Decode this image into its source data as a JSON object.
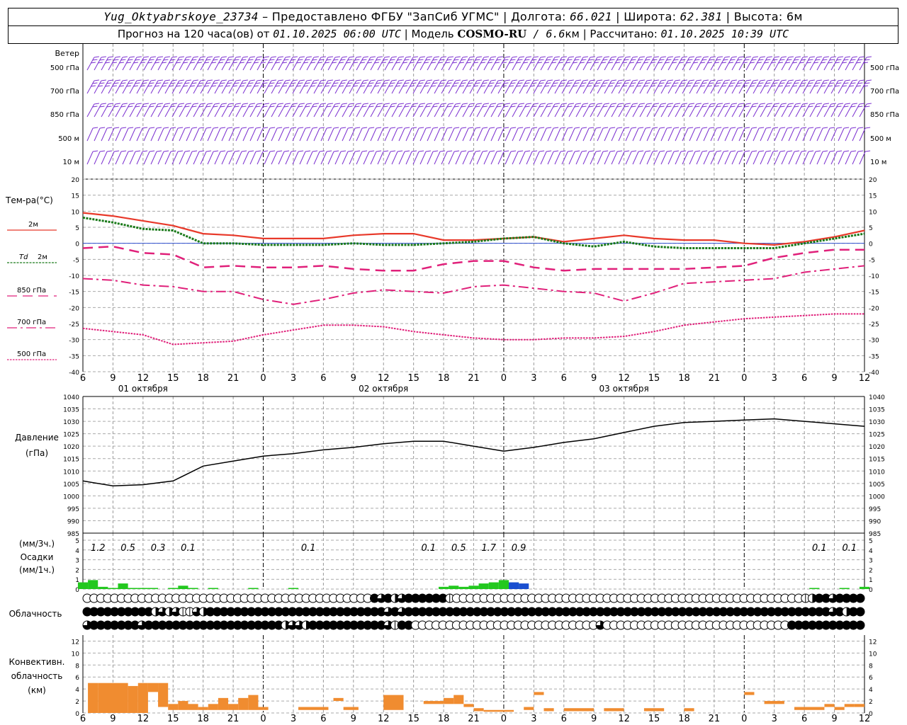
{
  "header": {
    "station": "Yug_Oktyabrskoye_23734",
    "provided_by": " – Предоставлено ФГБУ \"ЗапСиб УГМС\" | ",
    "lon_label": "Долгота: ",
    "lon_value": "66.021",
    "lat_label": " | Широта: ",
    "lat_value": "62.381",
    "alt_label": " | Высота: 6м",
    "forecast_label": "Прогноз на 120 часа(ов) от ",
    "forecast_start": "01.10.2025 06:00 UTC",
    "model_label": " | Модель ",
    "model_name": "COSMO-RU",
    "model_res": " / 6.6",
    "model_res_unit": "км",
    "calc_label": " | Рассчитано: ",
    "calc_time": "01.10.2025 10:39 UTC"
  },
  "time_axis": {
    "tick_labels": [
      "6",
      "9",
      "12",
      "15",
      "18",
      "21",
      "0",
      "3",
      "6",
      "9",
      "12",
      "15",
      "18",
      "21",
      "0",
      "3",
      "6",
      "9",
      "12",
      "15",
      "18",
      "21",
      "0",
      "3",
      "6",
      "9",
      "12"
    ],
    "day_labels": [
      "01 октября",
      "02 октября",
      "03 октября"
    ]
  },
  "wind_panel": {
    "title": "Ветер",
    "levels": [
      "500 гПа",
      "700 гПа",
      "850 гПа",
      "500 м",
      "10  м"
    ],
    "color": "#7b2fd0"
  },
  "temp_panel": {
    "title": "Тем-ра(°C)",
    "y_ticks": [
      "20",
      "15",
      "10",
      "5",
      "0",
      "-5",
      "-10",
      "-15",
      "-20",
      "-25",
      "-30",
      "-35",
      "-40"
    ],
    "legend": [
      {
        "label": "2м",
        "color": "#e8392a"
      },
      {
        "label": "Td",
        "label2": "2м",
        "color": "#1a7a1a"
      },
      {
        "label": "850 гПа",
        "color": "#e0207a"
      },
      {
        "label": "700 гПа",
        "color": "#e0207a"
      },
      {
        "label": "500 гПа",
        "color": "#e0207a"
      }
    ]
  },
  "pressure_panel": {
    "title": "Давление",
    "unit": "(гПа)",
    "y_ticks": [
      "1040",
      "1035",
      "1030",
      "1025",
      "1020",
      "1015",
      "1010",
      "1005",
      "1000",
      "995",
      "990",
      "985"
    ]
  },
  "precip_panel": {
    "unit_top": "(мм/3ч.)",
    "title": "Осадки",
    "unit_bottom": "(мм/1ч.)",
    "y_ticks": [
      "5",
      "4",
      "3",
      "2",
      "1",
      "0"
    ],
    "labels": [
      {
        "hour": 1.5,
        "text": "1.2"
      },
      {
        "hour": 4.5,
        "text": "0.5"
      },
      {
        "hour": 7.5,
        "text": "0.3"
      },
      {
        "hour": 10.5,
        "text": "0.1"
      },
      {
        "hour": 22.5,
        "text": "0.1"
      },
      {
        "hour": 34.5,
        "text": "0.1"
      },
      {
        "hour": 37.5,
        "text": "0.5"
      },
      {
        "hour": 40.5,
        "text": "1.7"
      },
      {
        "hour": 43.5,
        "text": "0.9"
      },
      {
        "hour": 73.5,
        "text": "0.1"
      },
      {
        "hour": 76.5,
        "text": "0.1"
      }
    ]
  },
  "cloud_panel": {
    "title": "Облачность"
  },
  "conv_panel": {
    "title1": "Конвективн.",
    "title2": "облачность",
    "unit": "(км)",
    "y_ticks": [
      "12",
      "10",
      "8",
      "6",
      "4",
      "2",
      "0"
    ],
    "color": "#f08c30"
  },
  "chart_data": [
    {
      "type": "line",
      "title": "Тем-ра(°C)",
      "ylim": [
        -40,
        20
      ],
      "x_hours_from_start": [
        0,
        3,
        6,
        9,
        12,
        15,
        18,
        21,
        24,
        27,
        30,
        33,
        36,
        39,
        42,
        45,
        48,
        51,
        54,
        57,
        60,
        63,
        66,
        69,
        72,
        75,
        78
      ],
      "series": [
        {
          "name": "2м",
          "values": [
            9.5,
            8.5,
            7,
            5.5,
            3,
            2.5,
            1.5,
            1.5,
            1.5,
            2.5,
            3,
            3,
            1,
            1,
            1.5,
            2,
            0.5,
            1.5,
            2.5,
            1.5,
            1,
            1,
            0,
            -0.5,
            0.5,
            2,
            4
          ]
        },
        {
          "name": "Td 2м",
          "values": [
            8,
            6.5,
            4.5,
            4,
            0,
            0,
            -0.5,
            -0.5,
            -0.5,
            0,
            -0.5,
            -0.5,
            0,
            0.5,
            1.5,
            2,
            0,
            -1,
            0.5,
            -1,
            -1.5,
            -1.5,
            -1.5,
            -1.5,
            0,
            1.5,
            3
          ]
        },
        {
          "name": "850 гПа",
          "values": [
            -1.5,
            -1,
            -3,
            -3.5,
            -7.5,
            -7,
            -7.5,
            -7.5,
            -7,
            -8,
            -8.5,
            -8.5,
            -6.5,
            -5.5,
            -5.5,
            -7.5,
            -8.5,
            -8,
            -8,
            -8,
            -8,
            -7.5,
            -7,
            -4.5,
            -3,
            -2,
            -2
          ]
        },
        {
          "name": "700 гПа",
          "values": [
            -11,
            -11.5,
            -13,
            -13.5,
            -15,
            -15,
            -17.5,
            -19,
            -17.5,
            -15.5,
            -14.5,
            -15,
            -15.5,
            -13.5,
            -13,
            -14,
            -15,
            -15.5,
            -18,
            -15.5,
            -12.5,
            -12,
            -11.5,
            -11,
            -9,
            -8,
            -7
          ]
        },
        {
          "name": "500 гПа",
          "values": [
            -26.5,
            -27.5,
            -28.5,
            -31.5,
            -31,
            -30.5,
            -28.5,
            -27,
            -25.5,
            -25.5,
            -26,
            -27.5,
            -28.5,
            -29.5,
            -30,
            -30,
            -29.5,
            -29.5,
            -29,
            -27.5,
            -25.5,
            -24.5,
            -23.5,
            -23,
            -22.5,
            -22,
            -22
          ]
        }
      ]
    },
    {
      "type": "line",
      "title": "Давление",
      "ylabel": "(гПа)",
      "ylim": [
        985,
        1040
      ],
      "x_hours_from_start": [
        0,
        3,
        6,
        9,
        12,
        15,
        18,
        21,
        24,
        27,
        30,
        33,
        36,
        39,
        42,
        45,
        48,
        51,
        54,
        57,
        60,
        63,
        66,
        69,
        72,
        75,
        78
      ],
      "series": [
        {
          "name": "Давление",
          "values": [
            1006,
            1004,
            1004.5,
            1006,
            1012,
            1014,
            1016,
            1017,
            1018.5,
            1019.5,
            1021,
            1022,
            1022,
            1020,
            1018,
            1019.5,
            1021.5,
            1023,
            1025.5,
            1028,
            1029.5,
            1030,
            1030.5,
            1031,
            1030,
            1029,
            1028
          ]
        }
      ]
    },
    {
      "type": "bar",
      "title": "Осадки",
      "ylabel": "(мм/1ч.)",
      "ylim": [
        0,
        5
      ],
      "x_hours_from_start": [
        0,
        1,
        2,
        3,
        4,
        5,
        6,
        7,
        8,
        9,
        10,
        11,
        12,
        13,
        14,
        15,
        16,
        17,
        18,
        19,
        20,
        21,
        22,
        23,
        24,
        25,
        26,
        27,
        28,
        29,
        30,
        31,
        32,
        33,
        34,
        35,
        36,
        37,
        38,
        39,
        40,
        41,
        42,
        43,
        44,
        45,
        46,
        47,
        48,
        49,
        50,
        51,
        52,
        53,
        54,
        55,
        56,
        57,
        58,
        59,
        60,
        61,
        62,
        63,
        64,
        65,
        66,
        67,
        68,
        69,
        70,
        71,
        72,
        73,
        74,
        75,
        76,
        77,
        78
      ],
      "series": [
        {
          "name": "rain",
          "values": [
            0.6,
            0.8,
            0.2,
            0.1,
            0.5,
            0.1,
            0.1,
            0.1,
            0,
            0.1,
            0.3,
            0.1,
            0,
            0.1,
            0,
            0,
            0,
            0.1,
            0,
            0,
            0,
            0.1,
            0,
            0,
            0,
            0,
            0,
            0,
            0,
            0,
            0,
            0,
            0,
            0,
            0,
            0,
            0.2,
            0.3,
            0.2,
            0.3,
            0.5,
            0.6,
            0.8,
            0.6,
            0,
            0,
            0,
            0,
            0,
            0,
            0,
            0,
            0,
            0,
            0,
            0,
            0,
            0,
            0,
            0,
            0,
            0,
            0,
            0,
            0,
            0,
            0,
            0,
            0,
            0,
            0,
            0,
            0,
            0.1,
            0,
            0,
            0.1,
            0,
            0.2
          ]
        },
        {
          "name": "snow",
          "values": [
            0,
            0,
            0,
            0,
            0,
            0,
            0,
            0,
            0,
            0,
            0,
            0,
            0,
            0,
            0,
            0,
            0,
            0,
            0,
            0,
            0,
            0,
            0,
            0,
            0,
            0,
            0,
            0,
            0,
            0,
            0,
            0,
            0,
            0,
            0,
            0,
            0,
            0,
            0,
            0,
            0,
            0,
            0,
            0.6,
            0.5,
            0,
            0,
            0,
            0,
            0,
            0,
            0,
            0,
            0,
            0,
            0,
            0,
            0,
            0,
            0,
            0,
            0,
            0,
            0,
            0,
            0,
            0,
            0,
            0,
            0,
            0,
            0,
            0,
            0,
            0,
            0,
            0,
            0,
            0
          ]
        }
      ]
    },
    {
      "type": "table",
      "title": "Облачность",
      "rows": [
        "000000000000000000000000000000000000000000434234444441000000000000000000000000000000000000000000000000000124434444",
        "444444444423231132444444444444444444444444443434444444444444444444444444444444444444444444444444444444444444434244",
        "344444443444444444444444444442332444444444443144000000000000000000000000000300000000000000000000000000044444444444"
      ]
    },
    {
      "type": "bar",
      "title": "Конвективн. облачность",
      "ylabel": "(км)",
      "ylim": [
        0,
        13
      ],
      "bars": [
        {
          "h0": 0.5,
          "h1": 1.5,
          "bottom": 0,
          "top": 5
        },
        {
          "h0": 1.5,
          "h1": 4.5,
          "bottom": 0,
          "top": 5
        },
        {
          "h0": 4.5,
          "h1": 5.5,
          "bottom": 0,
          "top": 4.5
        },
        {
          "h0": 5.5,
          "h1": 6.5,
          "bottom": 0,
          "top": 5
        },
        {
          "h0": 6.5,
          "h1": 7.5,
          "bottom": 3.5,
          "top": 5
        },
        {
          "h0": 7.5,
          "h1": 8.5,
          "bottom": 1,
          "top": 5
        },
        {
          "h0": 8.5,
          "h1": 9.5,
          "bottom": 0.5,
          "top": 1.5
        },
        {
          "h0": 9.5,
          "h1": 10.5,
          "bottom": 0.5,
          "top": 2
        },
        {
          "h0": 10.5,
          "h1": 11.5,
          "bottom": 0.5,
          "top": 1.5
        },
        {
          "h0": 11.5,
          "h1": 12.5,
          "bottom": 0.5,
          "top": 1
        },
        {
          "h0": 12.5,
          "h1": 13.5,
          "bottom": 0.5,
          "top": 1.5
        },
        {
          "h0": 13.5,
          "h1": 14.5,
          "bottom": 0.5,
          "top": 2.5
        },
        {
          "h0": 14.5,
          "h1": 15.5,
          "bottom": 0.5,
          "top": 1.5
        },
        {
          "h0": 15.5,
          "h1": 16.5,
          "bottom": 0.5,
          "top": 2.5
        },
        {
          "h0": 16.5,
          "h1": 17.5,
          "bottom": 0.5,
          "top": 3
        },
        {
          "h0": 17.5,
          "h1": 18.5,
          "bottom": 0.5,
          "top": 1
        },
        {
          "h0": 21.5,
          "h1": 24.5,
          "bottom": 0.5,
          "top": 1
        },
        {
          "h0": 25,
          "h1": 26,
          "bottom": 2,
          "top": 2.5
        },
        {
          "h0": 26,
          "h1": 27.5,
          "bottom": 0.5,
          "top": 1
        },
        {
          "h0": 30,
          "h1": 32,
          "bottom": 0.5,
          "top": 3
        },
        {
          "h0": 34,
          "h1": 36,
          "bottom": 1.5,
          "top": 2
        },
        {
          "h0": 36,
          "h1": 37,
          "bottom": 1.5,
          "top": 2.5
        },
        {
          "h0": 37,
          "h1": 38,
          "bottom": 1.5,
          "top": 3
        },
        {
          "h0": 38,
          "h1": 39,
          "bottom": 1,
          "top": 1.5
        },
        {
          "h0": 39,
          "h1": 40,
          "bottom": 0.3,
          "top": 0.8
        },
        {
          "h0": 40,
          "h1": 43,
          "bottom": 0.2,
          "top": 0.5
        },
        {
          "h0": 44,
          "h1": 45,
          "bottom": 0.5,
          "top": 1
        },
        {
          "h0": 45,
          "h1": 46,
          "bottom": 3,
          "top": 3.5
        },
        {
          "h0": 46,
          "h1": 47,
          "bottom": 0.3,
          "top": 0.8
        },
        {
          "h0": 48,
          "h1": 51,
          "bottom": 0.3,
          "top": 0.8
        },
        {
          "h0": 52,
          "h1": 54,
          "bottom": 0.3,
          "top": 0.8
        },
        {
          "h0": 56,
          "h1": 58,
          "bottom": 0.3,
          "top": 0.8
        },
        {
          "h0": 60,
          "h1": 61,
          "bottom": 0.3,
          "top": 0.8
        },
        {
          "h0": 66,
          "h1": 67,
          "bottom": 3,
          "top": 3.5
        },
        {
          "h0": 68,
          "h1": 70,
          "bottom": 1.5,
          "top": 2
        },
        {
          "h0": 71,
          "h1": 74,
          "bottom": 0.5,
          "top": 1
        },
        {
          "h0": 74,
          "h1": 75,
          "bottom": 1,
          "top": 1.5
        },
        {
          "h0": 75,
          "h1": 76,
          "bottom": 0.5,
          "top": 1
        },
        {
          "h0": 76,
          "h1": 77,
          "bottom": 1,
          "top": 1.5
        },
        {
          "h0": 77,
          "h1": 78,
          "bottom": 1,
          "top": 1.5
        }
      ]
    }
  ]
}
